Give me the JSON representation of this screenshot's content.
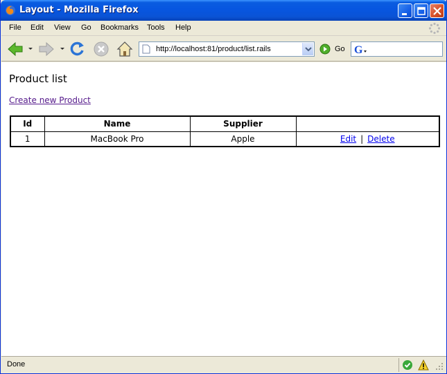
{
  "window": {
    "title": "Layout - Mozilla Firefox"
  },
  "menu": [
    "File",
    "Edit",
    "View",
    "Go",
    "Bookmarks",
    "Tools",
    "Help"
  ],
  "toolbar": {
    "url": "http://localhost:81/product/list.rails",
    "go_label": "Go",
    "search_engine": "google-icon"
  },
  "page": {
    "title": "Product list",
    "create_link": "Create new Product",
    "table": {
      "headers": [
        "Id",
        "Name",
        "Supplier",
        ""
      ],
      "rows": [
        {
          "id": "1",
          "name": "MacBook Pro",
          "supplier": "Apple",
          "edit": "Edit",
          "separator": "|",
          "delete": "Delete"
        }
      ]
    }
  },
  "status": {
    "text": "Done"
  },
  "colors": {
    "titlebar": "#0756e0",
    "visited_link": "#551a8b",
    "link": "#0000ee"
  }
}
